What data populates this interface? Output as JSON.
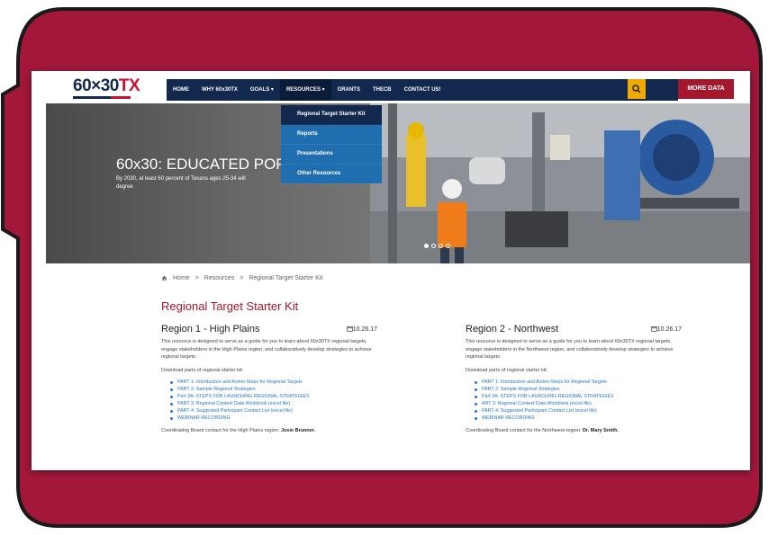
{
  "header": {
    "logo_text": "60×30",
    "logo_accent": "TX",
    "nav": [
      {
        "label": "HOME"
      },
      {
        "label": "WHY 60x30TX"
      },
      {
        "label": "GOALS ▾"
      },
      {
        "label": "RESOURCES ▾"
      },
      {
        "label": "GRANTS"
      },
      {
        "label": "THECB"
      },
      {
        "label": "CONTACT US!"
      }
    ],
    "more_data": "MORE DATA"
  },
  "dropdown": {
    "items": [
      {
        "label": "Regional Target Starter Kit"
      },
      {
        "label": "Reports"
      },
      {
        "label": "Presentations"
      },
      {
        "label": "Other Resources"
      }
    ]
  },
  "hero": {
    "title": "60x30: EDUCATED POPU",
    "subtitle": "By 2030, at least 60 percent of Texans ages 25-34 will",
    "subtitle2": "degree"
  },
  "breadcrumb": {
    "home": "Home",
    "sep": ">",
    "resources": "Resources",
    "current": "Regional Target Starter Kit"
  },
  "page_title": "Regional Target Starter Kit",
  "regions": [
    {
      "name": "Region 1 - High Plains",
      "date": "10.26.17",
      "desc": "This resource is designed to serve as a guide for you to learn about 60x30TX regional targets, engage stakeholders in the High Plains region, and collaboratively develop strategies to achieve regional targets.",
      "download_label": "Download parts of regional starter kit:",
      "parts": [
        "PART 1: Introduction and Action-Steps for Regional Targets",
        "PART 2: Sample Regional Strategies",
        "Part 3A: STEPS FOR LAUNCHING REGIONAL STRATEGIES",
        "PART 3: Regional Context Data Workbook (excel file)",
        "PART 4: Suggested Participant Contact List (excel file)",
        "WEBINAR RECORDING"
      ],
      "contact_prefix": "Coordinating Board contact for the High Plains region:",
      "contact_name": "Josie Brunner."
    },
    {
      "name": "Region 2 - Northwest",
      "date": "10.26.17",
      "desc": "This resource is designed to serve as a guide for you to learn about 60x30TX regional targets, engage stakeholders in the Northwest region, and collaboratively develop strategies to achieve regional targets.",
      "download_label": "Download parts of regional starter kit:",
      "parts": [
        "PART 1: Introduction and Action-Steps for Regional Targets",
        "PART 2: Sample Regional Strategies",
        "Part 3A: STEPS FOR LAUNCHING REGIONAL STRATEGIES",
        "ART 3: Regional Context Data Workbook (excel file)",
        "PART 4: Suggested Participant Contact List (excel file)",
        "WEBINAR RECORDING"
      ],
      "contact_prefix": "Coordinating Board contact for the Northwest region:",
      "contact_name": "Dr. Mary Smith."
    }
  ],
  "colors": {
    "bubble": "#a3183a",
    "nav": "#12284c",
    "dropdown": "#1f6fb0",
    "title_red": "#a3182d",
    "link_blue": "#2a74c6",
    "search": "#f4a900"
  },
  "icons": [
    "search-icon",
    "home-icon",
    "calendar-icon"
  ]
}
